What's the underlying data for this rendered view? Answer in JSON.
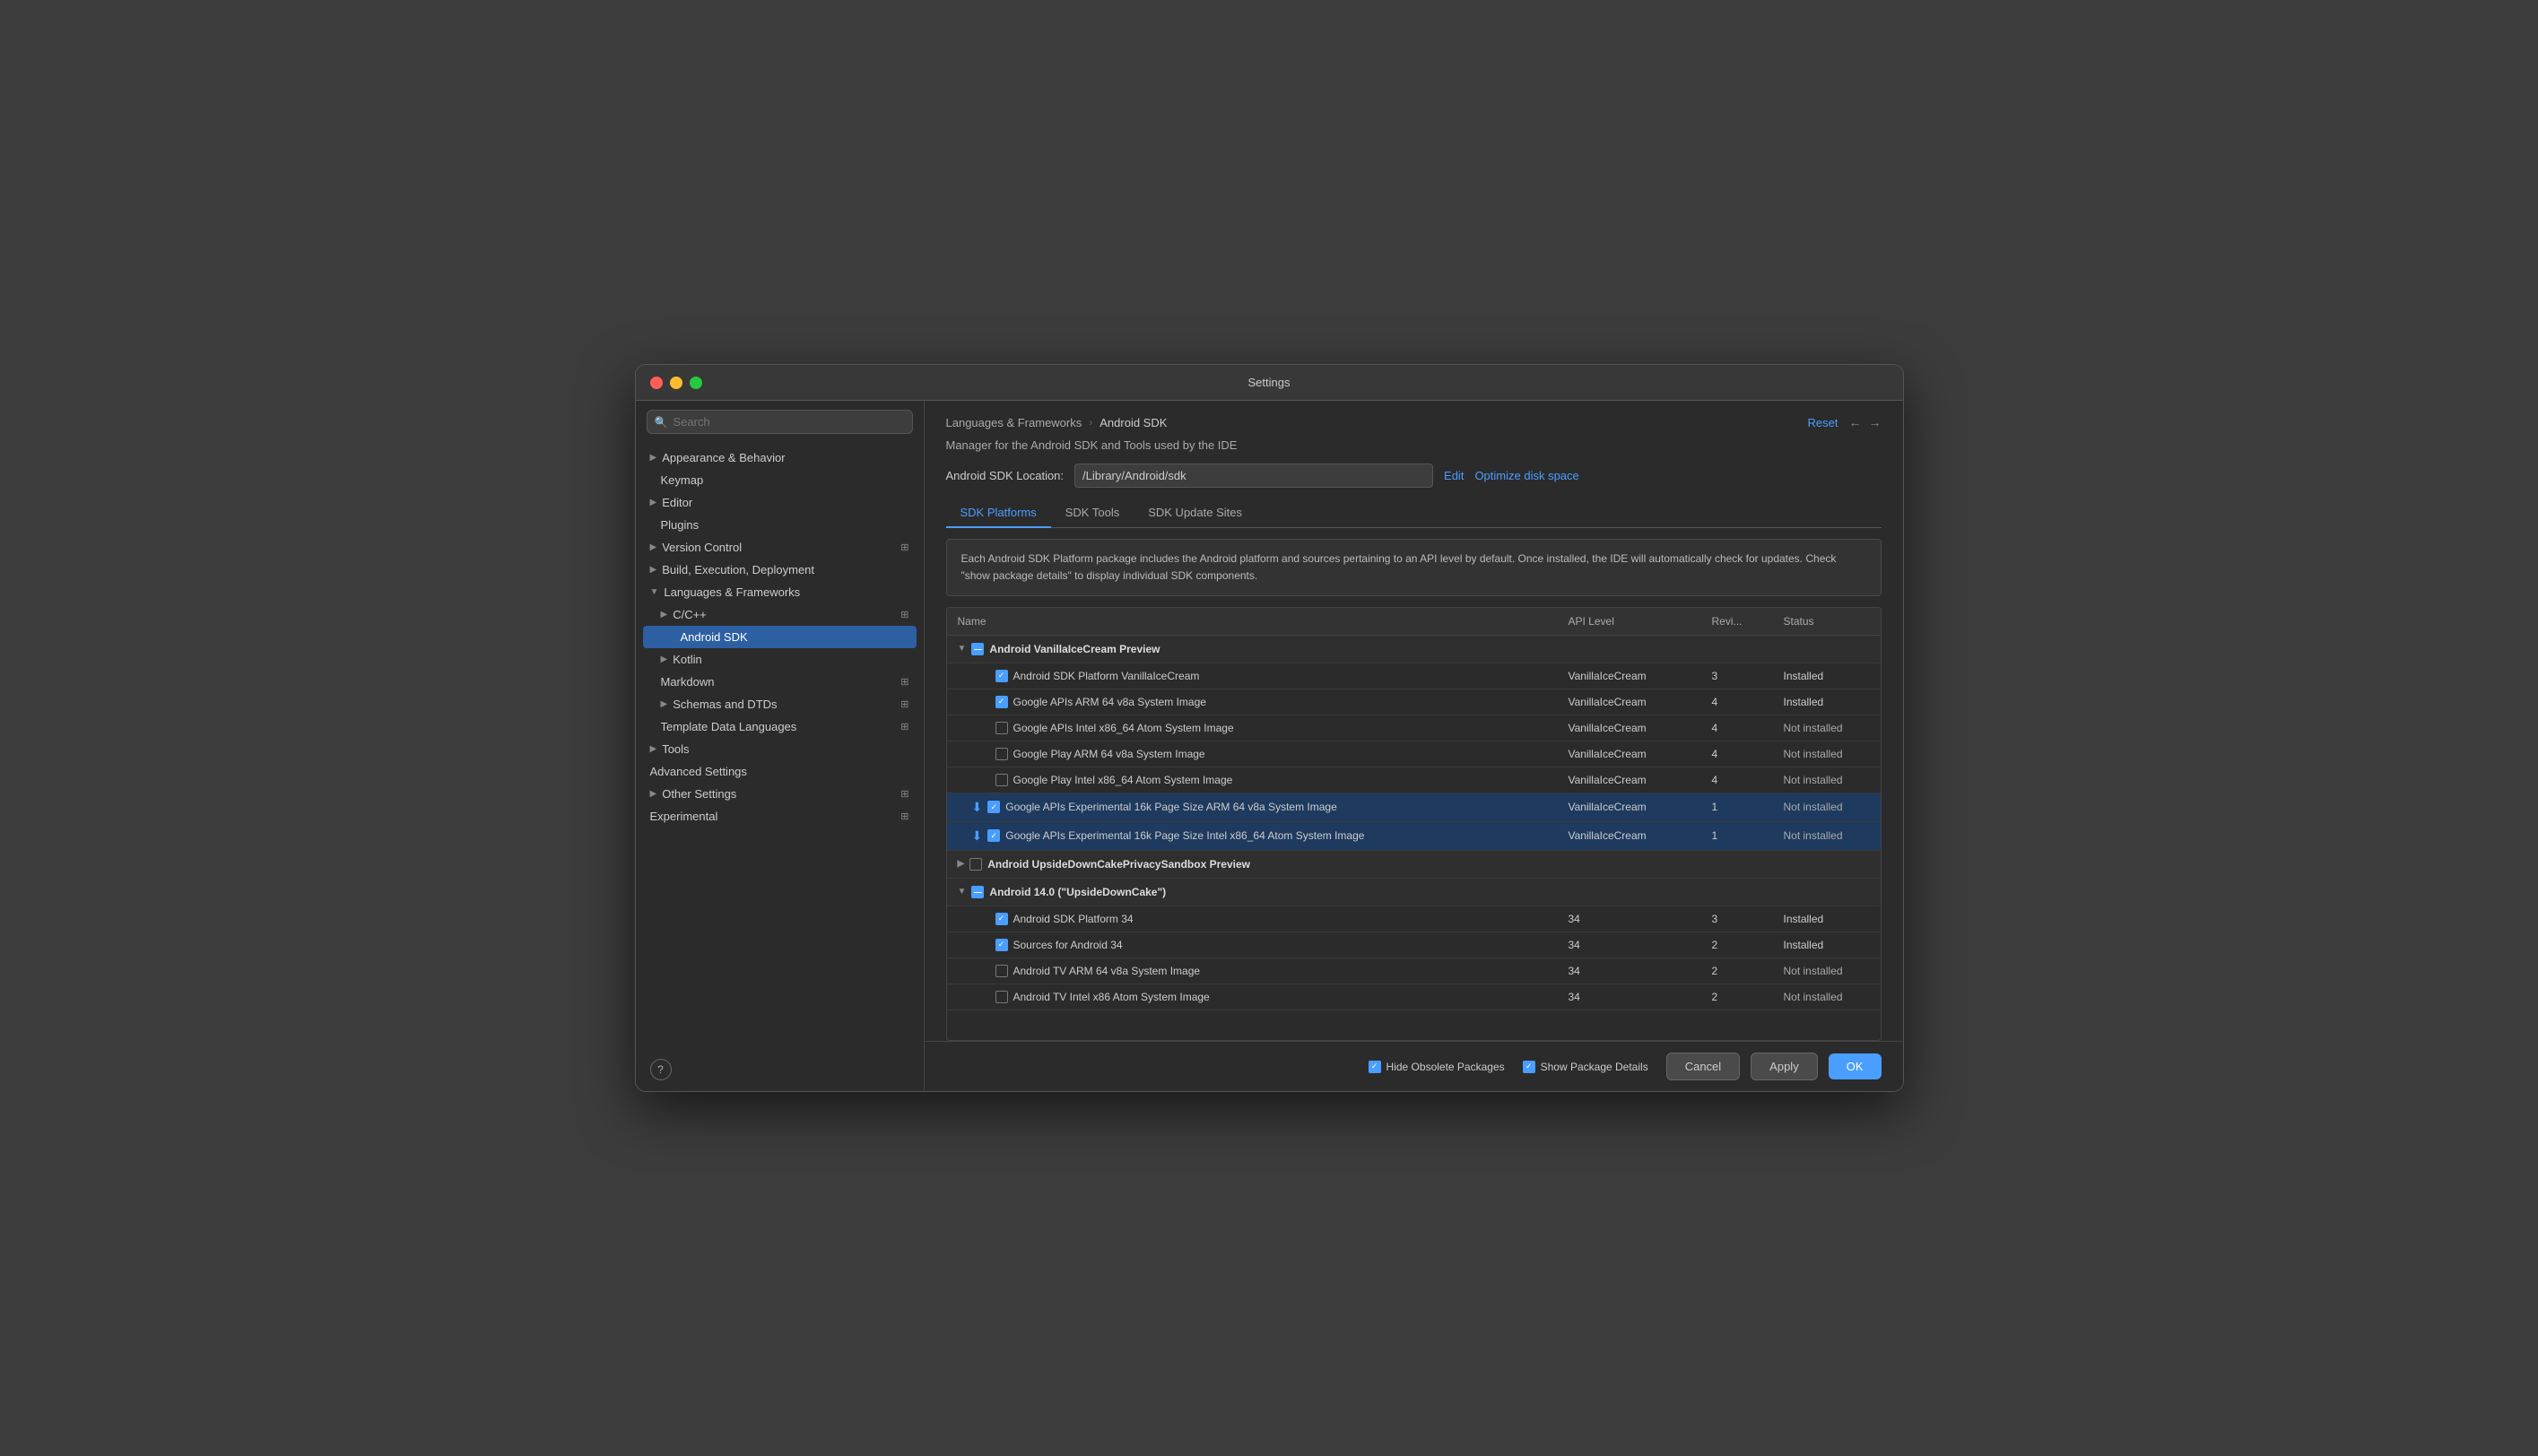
{
  "window": {
    "title": "Settings"
  },
  "breadcrumb": {
    "parent": "Languages & Frameworks",
    "current": "Android SDK",
    "reset": "Reset"
  },
  "description": "Manager for the Android SDK and Tools used by the IDE",
  "sdk_location": {
    "label": "Android SDK Location:",
    "path": "/Library/Android/sdk",
    "edit": "Edit",
    "optimize": "Optimize disk space"
  },
  "tabs": [
    {
      "label": "SDK Platforms",
      "active": true
    },
    {
      "label": "SDK Tools",
      "active": false
    },
    {
      "label": "SDK Update Sites",
      "active": false
    }
  ],
  "info_box": "Each Android SDK Platform package includes the Android platform and sources pertaining to an API level by default. Once installed, the IDE will automatically check for updates. Check \"show package details\" to display individual SDK components.",
  "table": {
    "headers": [
      "Name",
      "API Level",
      "Revi...",
      "Status"
    ],
    "groups": [
      {
        "name": "Android VanillaIceCream Preview",
        "checkbox": "partial",
        "expanded": true,
        "rows": [
          {
            "name": "Android SDK Platform VanillaIceCream",
            "api": "VanillaIceCream",
            "rev": "3",
            "status": "Installed",
            "checked": true,
            "download": false,
            "highlighted": false
          },
          {
            "name": "Google APIs ARM 64 v8a System Image",
            "api": "VanillaIceCream",
            "rev": "4",
            "status": "Installed",
            "checked": true,
            "download": false,
            "highlighted": false
          },
          {
            "name": "Google APIs Intel x86_64 Atom System Image",
            "api": "VanillaIceCream",
            "rev": "4",
            "status": "Not installed",
            "checked": false,
            "download": false,
            "highlighted": false
          },
          {
            "name": "Google Play ARM 64 v8a System Image",
            "api": "VanillaIceCream",
            "rev": "4",
            "status": "Not installed",
            "checked": false,
            "download": false,
            "highlighted": false
          },
          {
            "name": "Google Play Intel x86_64 Atom System Image",
            "api": "VanillaIceCream",
            "rev": "4",
            "status": "Not installed",
            "checked": false,
            "download": false,
            "highlighted": false
          },
          {
            "name": "Google APIs Experimental 16k Page Size ARM 64 v8a System Image",
            "api": "VanillaIceCream",
            "rev": "1",
            "status": "Not installed",
            "checked": true,
            "download": true,
            "highlighted": true
          },
          {
            "name": "Google APIs Experimental 16k Page Size Intel x86_64 Atom System Image",
            "api": "VanillaIceCream",
            "rev": "1",
            "status": "Not installed",
            "checked": true,
            "download": true,
            "highlighted": true
          }
        ]
      },
      {
        "name": "Android UpsideDownCakePrivacySandbox Preview",
        "checkbox": "unchecked",
        "expanded": false,
        "rows": []
      },
      {
        "name": "Android 14.0 (\"UpsideDownCake\")",
        "checkbox": "partial",
        "expanded": true,
        "rows": [
          {
            "name": "Android SDK Platform 34",
            "api": "34",
            "rev": "3",
            "status": "Installed",
            "checked": true,
            "download": false,
            "highlighted": false
          },
          {
            "name": "Sources for Android 34",
            "api": "34",
            "rev": "2",
            "status": "Installed",
            "checked": true,
            "download": false,
            "highlighted": false
          },
          {
            "name": "Android TV ARM 64 v8a System Image",
            "api": "34",
            "rev": "2",
            "status": "Not installed",
            "checked": false,
            "download": false,
            "highlighted": false
          },
          {
            "name": "Android TV Intel x86 Atom System Image",
            "api": "34",
            "rev": "2",
            "status": "Not installed",
            "checked": false,
            "download": false,
            "highlighted": false
          }
        ]
      }
    ]
  },
  "footer": {
    "hide_obsolete": {
      "label": "Hide Obsolete Packages",
      "checked": true
    },
    "show_details": {
      "label": "Show Package Details",
      "checked": true
    },
    "cancel": "Cancel",
    "apply": "Apply",
    "ok": "OK"
  },
  "sidebar": {
    "search_placeholder": "Search",
    "items": [
      {
        "label": "Appearance & Behavior",
        "indent": 0,
        "expandable": true,
        "selected": false
      },
      {
        "label": "Keymap",
        "indent": 1,
        "expandable": false,
        "selected": false
      },
      {
        "label": "Editor",
        "indent": 0,
        "expandable": true,
        "selected": false
      },
      {
        "label": "Plugins",
        "indent": 1,
        "expandable": false,
        "selected": false
      },
      {
        "label": "Version Control",
        "indent": 0,
        "expandable": true,
        "selected": false,
        "has_action": true
      },
      {
        "label": "Build, Execution, Deployment",
        "indent": 0,
        "expandable": true,
        "selected": false
      },
      {
        "label": "Languages & Frameworks",
        "indent": 0,
        "expandable": true,
        "selected": false,
        "expanded": true
      },
      {
        "label": "C/C++",
        "indent": 1,
        "expandable": true,
        "selected": false,
        "has_action": true
      },
      {
        "label": "Android SDK",
        "indent": 2,
        "expandable": false,
        "selected": true
      },
      {
        "label": "Kotlin",
        "indent": 1,
        "expandable": true,
        "selected": false
      },
      {
        "label": "Markdown",
        "indent": 1,
        "expandable": false,
        "selected": false,
        "has_action": true
      },
      {
        "label": "Schemas and DTDs",
        "indent": 1,
        "expandable": true,
        "selected": false,
        "has_action": true
      },
      {
        "label": "Template Data Languages",
        "indent": 1,
        "expandable": false,
        "selected": false,
        "has_action": true
      },
      {
        "label": "Tools",
        "indent": 0,
        "expandable": true,
        "selected": false
      },
      {
        "label": "Advanced Settings",
        "indent": 0,
        "expandable": false,
        "selected": false
      },
      {
        "label": "Other Settings",
        "indent": 0,
        "expandable": true,
        "selected": false,
        "has_action": true
      },
      {
        "label": "Experimental",
        "indent": 0,
        "expandable": false,
        "selected": false,
        "has_action": true
      }
    ]
  }
}
